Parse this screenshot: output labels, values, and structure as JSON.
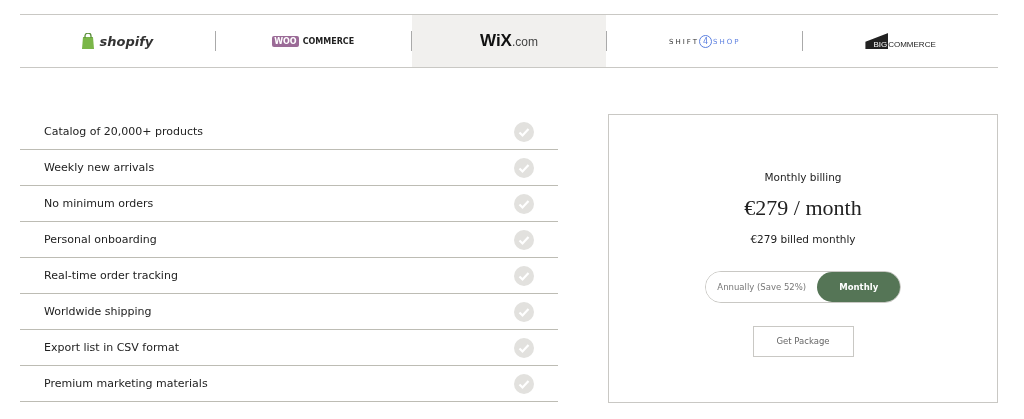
{
  "platform_tabs": [
    {
      "kind": "shopify",
      "name": "shopify",
      "selected": false
    },
    {
      "kind": "woocommerce",
      "badge": "WOO",
      "name": "COMMERCE",
      "selected": false
    },
    {
      "kind": "wix",
      "name": "WiX",
      "suffix": ".com",
      "selected": true
    },
    {
      "kind": "shift4shop",
      "name": "SHIFT",
      "badge": "4",
      "suffix": "SHOP",
      "selected": false
    },
    {
      "kind": "bigcommerce",
      "badge": "BIG",
      "name": "COMMERCE",
      "selected": false
    }
  ],
  "features": [
    {
      "label": "Catalog of 20,000+ products",
      "included": true
    },
    {
      "label": "Weekly new arrivals",
      "included": true
    },
    {
      "label": "No minimum orders",
      "included": true
    },
    {
      "label": "Personal onboarding",
      "included": true
    },
    {
      "label": "Real-time order tracking",
      "included": true
    },
    {
      "label": "Worldwide shipping",
      "included": true
    },
    {
      "label": "Export list in CSV format",
      "included": true
    },
    {
      "label": "Premium marketing materials",
      "included": true
    }
  ],
  "pricing": {
    "billing_label": "Monthly billing",
    "price": "€279 / month",
    "billed_note": "€279 billed monthly",
    "billing_options": [
      {
        "label": "Annually (Save 52%)",
        "selected": false
      },
      {
        "label": "Monthly",
        "selected": true
      }
    ],
    "button": "Get Package"
  }
}
